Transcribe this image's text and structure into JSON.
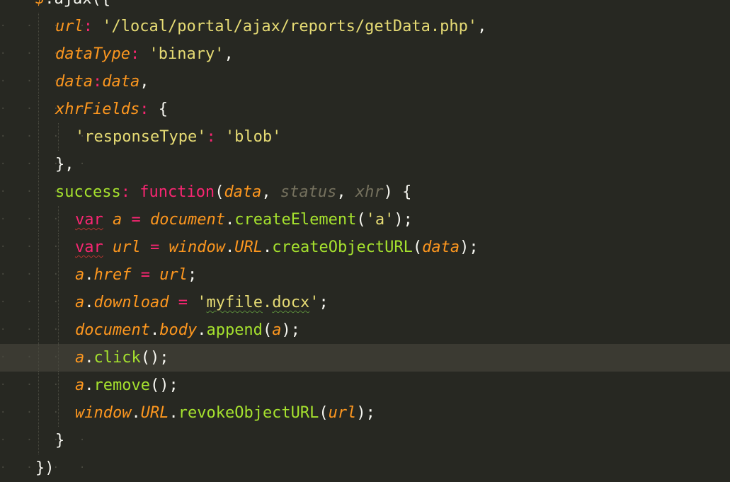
{
  "theme": {
    "background": "#272822",
    "active_line": "#3b3a32",
    "colors": {
      "plain": "#f8f8f2",
      "string": "#e6db74",
      "keyword": "#f92672",
      "function": "#a6e22e",
      "parameter": "#fd971f",
      "comment": "#75715e"
    }
  },
  "editor": {
    "active_line_index": 13,
    "lines": [
      {
        "indent": 0,
        "tokens": [
          {
            "t": "$",
            "c": "t-dollar"
          },
          {
            "t": ".",
            "c": "t-punc"
          },
          {
            "t": "ajax",
            "c": "t-plain"
          },
          {
            "t": "({",
            "c": "t-punc"
          }
        ]
      },
      {
        "indent": 1,
        "tokens": [
          {
            "t": "url",
            "c": "t-key"
          },
          {
            "t": ":",
            "c": "t-op"
          },
          {
            "t": " ",
            "c": "t-plain"
          },
          {
            "t": "'/local/portal/ajax/reports/getData.php'",
            "c": "t-str"
          },
          {
            "t": ",",
            "c": "t-punc"
          }
        ]
      },
      {
        "indent": 1,
        "tokens": [
          {
            "t": "dataType",
            "c": "t-key"
          },
          {
            "t": ":",
            "c": "t-op"
          },
          {
            "t": " ",
            "c": "t-plain"
          },
          {
            "t": "'binary'",
            "c": "t-str"
          },
          {
            "t": ",",
            "c": "t-punc"
          }
        ]
      },
      {
        "indent": 1,
        "tokens": [
          {
            "t": "data",
            "c": "t-key"
          },
          {
            "t": ":",
            "c": "t-op"
          },
          {
            "t": "data",
            "c": "t-param"
          },
          {
            "t": ",",
            "c": "t-punc"
          }
        ]
      },
      {
        "indent": 1,
        "tokens": [
          {
            "t": "xhrFields",
            "c": "t-key"
          },
          {
            "t": ":",
            "c": "t-op"
          },
          {
            "t": " {",
            "c": "t-punc"
          }
        ]
      },
      {
        "indent": 2,
        "tokens": [
          {
            "t": "'responseType'",
            "c": "t-str"
          },
          {
            "t": ":",
            "c": "t-op"
          },
          {
            "t": " ",
            "c": "t-plain"
          },
          {
            "t": "'blob'",
            "c": "t-str"
          }
        ]
      },
      {
        "indent": 1,
        "tokens": [
          {
            "t": "},",
            "c": "t-punc"
          }
        ]
      },
      {
        "indent": 1,
        "tokens": [
          {
            "t": "success",
            "c": "t-key2"
          },
          {
            "t": ":",
            "c": "t-op"
          },
          {
            "t": " ",
            "c": "t-plain"
          },
          {
            "t": "function",
            "c": "t-kw"
          },
          {
            "t": "(",
            "c": "t-punc"
          },
          {
            "t": "data",
            "c": "t-param"
          },
          {
            "t": ", ",
            "c": "t-punc"
          },
          {
            "t": "status",
            "c": "t-unused"
          },
          {
            "t": ", ",
            "c": "t-punc"
          },
          {
            "t": "xhr",
            "c": "t-unused"
          },
          {
            "t": ") {",
            "c": "t-punc"
          }
        ]
      },
      {
        "indent": 2,
        "tokens": [
          {
            "t": "var",
            "c": "t-kw sqr"
          },
          {
            "t": " ",
            "c": "t-plain"
          },
          {
            "t": "a",
            "c": "t-param"
          },
          {
            "t": " = ",
            "c": "t-op"
          },
          {
            "t": "document",
            "c": "t-obj"
          },
          {
            "t": ".",
            "c": "t-punc"
          },
          {
            "t": "createElement",
            "c": "t-fn"
          },
          {
            "t": "(",
            "c": "t-punc"
          },
          {
            "t": "'a'",
            "c": "t-str"
          },
          {
            "t": ");",
            "c": "t-punc"
          }
        ]
      },
      {
        "indent": 2,
        "tokens": [
          {
            "t": "var",
            "c": "t-kw sqr"
          },
          {
            "t": " ",
            "c": "t-plain"
          },
          {
            "t": "url",
            "c": "t-param"
          },
          {
            "t": " = ",
            "c": "t-op"
          },
          {
            "t": "window",
            "c": "t-obj"
          },
          {
            "t": ".",
            "c": "t-punc"
          },
          {
            "t": "URL",
            "c": "t-obj"
          },
          {
            "t": ".",
            "c": "t-punc"
          },
          {
            "t": "createObjectURL",
            "c": "t-fn"
          },
          {
            "t": "(",
            "c": "t-punc"
          },
          {
            "t": "data",
            "c": "t-param"
          },
          {
            "t": ");",
            "c": "t-punc"
          }
        ]
      },
      {
        "indent": 2,
        "tokens": [
          {
            "t": "a",
            "c": "t-param"
          },
          {
            "t": ".",
            "c": "t-punc"
          },
          {
            "t": "href",
            "c": "t-obj"
          },
          {
            "t": " = ",
            "c": "t-op"
          },
          {
            "t": "url",
            "c": "t-param"
          },
          {
            "t": ";",
            "c": "t-punc"
          }
        ]
      },
      {
        "indent": 2,
        "tokens": [
          {
            "t": "a",
            "c": "t-param"
          },
          {
            "t": ".",
            "c": "t-punc"
          },
          {
            "t": "download",
            "c": "t-obj"
          },
          {
            "t": " = ",
            "c": "t-op"
          },
          {
            "t": "'",
            "c": "t-str"
          },
          {
            "t": "myfile",
            "c": "t-str sq"
          },
          {
            "t": ".",
            "c": "t-str"
          },
          {
            "t": "docx",
            "c": "t-str sq"
          },
          {
            "t": "'",
            "c": "t-str"
          },
          {
            "t": ";",
            "c": "t-punc"
          }
        ]
      },
      {
        "indent": 2,
        "tokens": [
          {
            "t": "document",
            "c": "t-obj"
          },
          {
            "t": ".",
            "c": "t-punc"
          },
          {
            "t": "body",
            "c": "t-obj"
          },
          {
            "t": ".",
            "c": "t-punc"
          },
          {
            "t": "append",
            "c": "t-fn"
          },
          {
            "t": "(",
            "c": "t-punc"
          },
          {
            "t": "a",
            "c": "t-param"
          },
          {
            "t": ");",
            "c": "t-punc"
          }
        ]
      },
      {
        "indent": 2,
        "tokens": [
          {
            "t": "a",
            "c": "t-param"
          },
          {
            "t": ".",
            "c": "t-punc"
          },
          {
            "t": "click",
            "c": "t-fn"
          },
          {
            "t": "();",
            "c": "t-punc"
          }
        ]
      },
      {
        "indent": 2,
        "tokens": [
          {
            "t": "a",
            "c": "t-param"
          },
          {
            "t": ".",
            "c": "t-punc"
          },
          {
            "t": "remove",
            "c": "t-fn"
          },
          {
            "t": "();",
            "c": "t-punc"
          }
        ]
      },
      {
        "indent": 2,
        "tokens": [
          {
            "t": "window",
            "c": "t-obj"
          },
          {
            "t": ".",
            "c": "t-punc"
          },
          {
            "t": "URL",
            "c": "t-obj"
          },
          {
            "t": ".",
            "c": "t-punc"
          },
          {
            "t": "revokeObjectURL",
            "c": "t-fn"
          },
          {
            "t": "(",
            "c": "t-punc"
          },
          {
            "t": "url",
            "c": "t-param"
          },
          {
            "t": ");",
            "c": "t-punc"
          }
        ]
      },
      {
        "indent": 1,
        "tokens": [
          {
            "t": "}",
            "c": "t-punc"
          }
        ]
      },
      {
        "indent": 0,
        "tokens": [
          {
            "t": "})",
            "c": "t-punc"
          }
        ]
      }
    ]
  }
}
